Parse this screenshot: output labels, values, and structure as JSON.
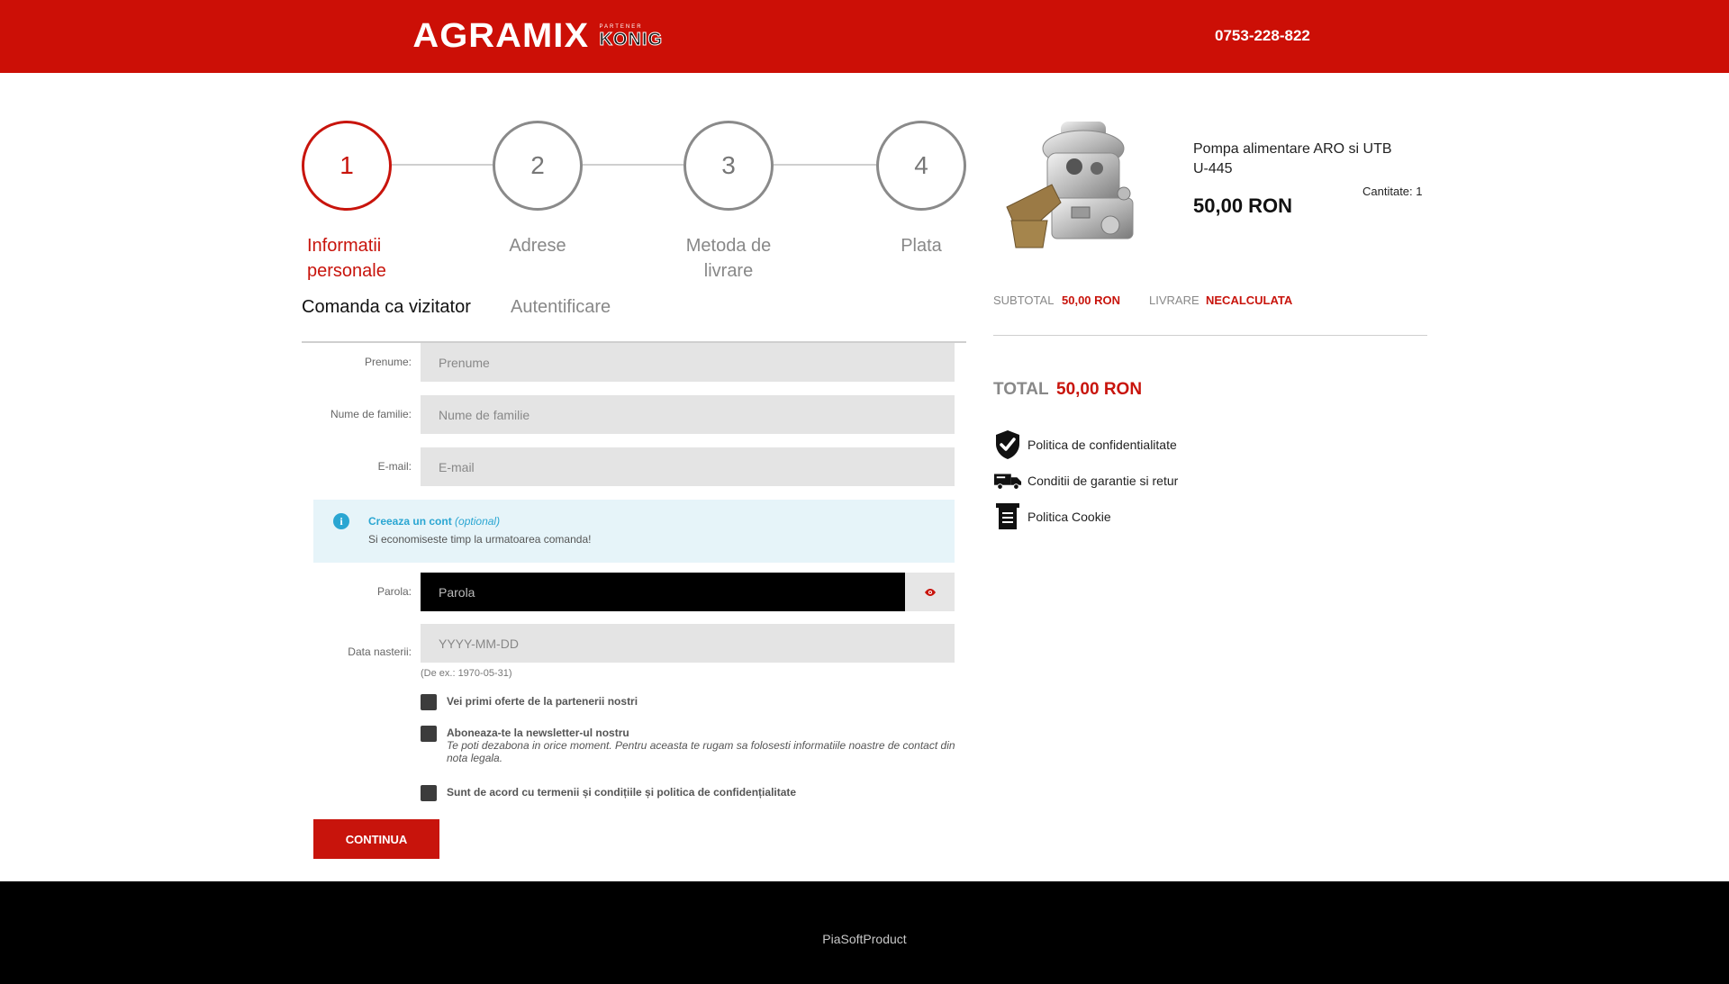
{
  "header": {
    "logo_text": "AGRAMIX",
    "partner_small": "PARTENER",
    "partner_name": "KONIG",
    "phone": "0753-228-822",
    "brand_color": "#cc0f06"
  },
  "steps": [
    {
      "number": "1",
      "label": "Informatii personale",
      "active": true
    },
    {
      "number": "2",
      "label": "Adrese",
      "active": false
    },
    {
      "number": "3",
      "label": "Metoda de livrare",
      "active": false
    },
    {
      "number": "4",
      "label": "Plata",
      "active": false
    }
  ],
  "tabs": {
    "guest": "Comanda ca vizitator",
    "login": "Autentificare"
  },
  "form": {
    "first_name_label": "Prenume:",
    "first_name_placeholder": "Prenume",
    "last_name_label": "Nume de familie:",
    "last_name_placeholder": "Nume de familie",
    "email_label": "E-mail:",
    "email_placeholder": "E-mail",
    "info_title": "Creeaza un cont",
    "info_optional": "(optional)",
    "info_sub": "Si economiseste timp la urmatoarea comanda!",
    "password_label": "Parola:",
    "password_placeholder": "Parola",
    "birthdate_label": "Data nasterii:",
    "birthdate_placeholder": "YYYY-MM-DD",
    "birthdate_hint": "(De ex.: 1970-05-31)",
    "offers_label": "Vei primi oferte de la partenerii nostri",
    "newsletter_label": "Aboneaza-te la newsletter-ul nostru",
    "newsletter_note": "Te poti dezabona in orice moment. Pentru aceasta te rugam sa folosesti informatiile noastre de contact din nota legala.",
    "terms_label": "Sunt de acord cu termenii și condițiile și politica de confidențialitate",
    "continue_label": "CONTINUA"
  },
  "cart": {
    "product_name": "Pompa alimentare ARO si UTB U-445",
    "quantity": "Cantitate: 1",
    "price": "50,00 RON",
    "subtotal_label": "SUBTOTAL",
    "subtotal_value": "50,00 RON",
    "shipping_label": "LIVRARE",
    "shipping_value": "NECALCULATA",
    "total_label": "TOTAL",
    "total_value": "50,00 RON"
  },
  "policies": [
    {
      "icon": "shield-check-icon",
      "label": "Politica de confidentialitate"
    },
    {
      "icon": "delivery-truck-icon",
      "label": "Conditii de garantie si retur"
    },
    {
      "icon": "cookie-document-icon",
      "label": "Politica Cookie"
    }
  ],
  "footer": {
    "text": "PiaSoftProduct"
  }
}
